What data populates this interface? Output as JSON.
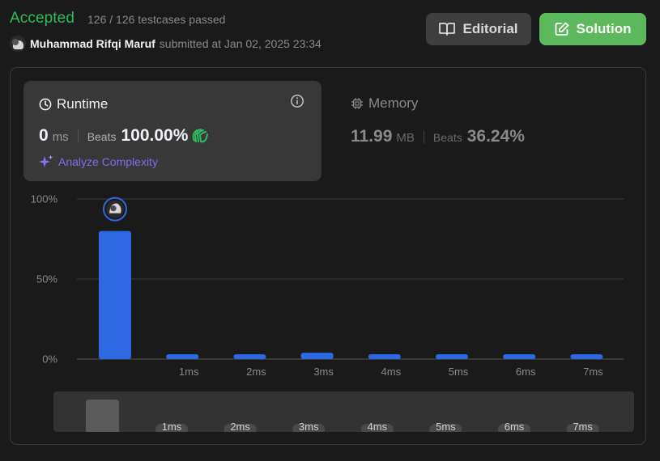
{
  "header": {
    "status": "Accepted",
    "testcases": "126 / 126 testcases passed",
    "username": "Muhammad Rifqi Maruf",
    "submitted_text": "submitted at Jan 02, 2025 23:34"
  },
  "buttons": {
    "editorial": "Editorial",
    "solution": "Solution"
  },
  "runtime": {
    "title": "Runtime",
    "value": "0",
    "unit": "ms",
    "beats_label": "Beats",
    "beats": "100.00%",
    "analyze": "Analyze Complexity"
  },
  "memory": {
    "title": "Memory",
    "value": "11.99",
    "unit": "MB",
    "beats_label": "Beats",
    "beats": "36.24%"
  },
  "colors": {
    "accepted": "#2cbb5d",
    "bar": "#2d69e3",
    "solution_button": "#5cb85c",
    "analyze": "#7d6ff2"
  },
  "chart_data": {
    "type": "bar",
    "categories": [
      "",
      "1ms",
      "2ms",
      "3ms",
      "4ms",
      "5ms",
      "6ms",
      "7ms"
    ],
    "values": [
      80,
      3,
      3,
      4,
      3,
      3,
      3,
      3
    ],
    "y_ticks": [
      "100%",
      "50%",
      "0%"
    ],
    "ylim": [
      0,
      100
    ],
    "grid": true,
    "highlight_index": 0
  },
  "range_selector": {
    "labels": [
      "1ms",
      "2ms",
      "3ms",
      "4ms",
      "5ms",
      "6ms",
      "7ms"
    ]
  }
}
